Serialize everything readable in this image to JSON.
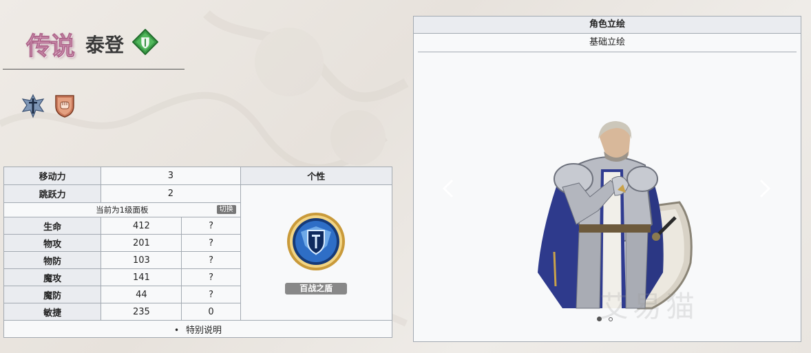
{
  "header": {
    "rarity": "传说",
    "name": "泰登",
    "class_icon": "green-diamond-shield-icon",
    "class_color": "#3a9a46"
  },
  "icons": [
    "winged-sword-emblem-icon",
    "fist-shield-icon"
  ],
  "stats_table": {
    "rows_top": [
      {
        "label": "移动力",
        "value": "3"
      },
      {
        "label": "跳跃力",
        "value": "2"
      }
    ],
    "panel_text": "当前为1级面板",
    "switch_label": "切换",
    "stats": [
      {
        "label": "生命",
        "value": "412",
        "growth": "?"
      },
      {
        "label": "物攻",
        "value": "201",
        "growth": "?"
      },
      {
        "label": "物防",
        "value": "103",
        "growth": "?"
      },
      {
        "label": "魔攻",
        "value": "141",
        "growth": "?"
      },
      {
        "label": "魔防",
        "value": "44",
        "growth": "?"
      },
      {
        "label": "敏捷",
        "value": "235",
        "growth": "0"
      }
    ],
    "personality_header": "个性",
    "skill_icon": "shield-emblem-icon",
    "skill_name": "百战之盾",
    "note": "特别说明"
  },
  "portrait_panel": {
    "title": "角色立绘",
    "tab": "基础立绘",
    "image": "armored-knight-with-shield-portrait",
    "watermark": "艾易猫",
    "carousel_dots": 2,
    "active_dot": 0
  },
  "colors": {
    "table_header_bg": "#eaecf0",
    "table_border": "#a2a9b1",
    "rarity_pink": "#ecb7cf"
  }
}
